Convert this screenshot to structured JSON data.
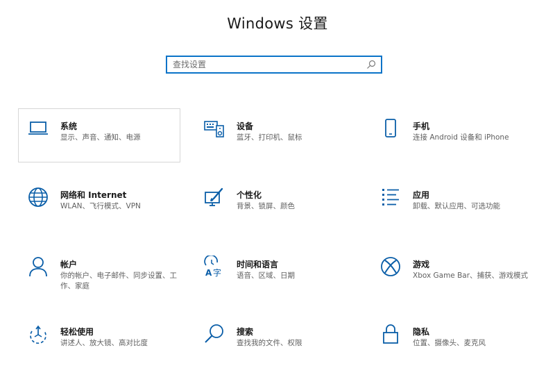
{
  "header": {
    "title": "Windows 设置"
  },
  "search": {
    "placeholder": "查找设置",
    "icon": "search-icon"
  },
  "accent_color": "#0a73c8",
  "tiles": [
    {
      "id": "system",
      "title": "系统",
      "desc": "显示、声音、通知、电源",
      "icon": "laptop-icon",
      "selected": true
    },
    {
      "id": "devices",
      "title": "设备",
      "desc": "蓝牙、打印机、鼠标",
      "icon": "devices-icon"
    },
    {
      "id": "phone",
      "title": "手机",
      "desc": "连接 Android 设备和 iPhone",
      "icon": "phone-icon"
    },
    {
      "id": "network",
      "title": "网络和 Internet",
      "desc": "WLAN、飞行模式、VPN",
      "icon": "globe-icon"
    },
    {
      "id": "personalization",
      "title": "个性化",
      "desc": "背景、锁屏、颜色",
      "icon": "paintbrush-icon"
    },
    {
      "id": "apps",
      "title": "应用",
      "desc": "卸载、默认应用、可选功能",
      "icon": "apps-list-icon"
    },
    {
      "id": "accounts",
      "title": "帐户",
      "desc": "你的帐户、电子邮件、同步设置、工作、家庭",
      "icon": "person-icon"
    },
    {
      "id": "time-language",
      "title": "时间和语言",
      "desc": "语音、区域、日期",
      "icon": "time-language-icon"
    },
    {
      "id": "gaming",
      "title": "游戏",
      "desc": "Xbox Game Bar、捕获、游戏模式",
      "icon": "xbox-icon"
    },
    {
      "id": "ease-of-access",
      "title": "轻松使用",
      "desc": "讲述人、放大镜、高对比度",
      "icon": "ease-of-access-icon"
    },
    {
      "id": "search",
      "title": "搜索",
      "desc": "查找我的文件、权限",
      "icon": "search-icon"
    },
    {
      "id": "privacy",
      "title": "隐私",
      "desc": "位置、摄像头、麦克风",
      "icon": "lock-icon"
    }
  ]
}
